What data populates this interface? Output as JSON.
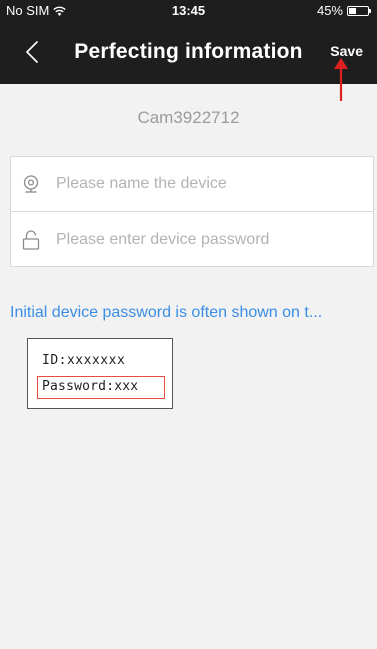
{
  "status_bar": {
    "carrier": "No SIM",
    "time": "13:45",
    "battery_percent": "45%",
    "battery_level": 0.45,
    "icons": [
      "wifi-icon",
      "battery-icon"
    ]
  },
  "nav": {
    "title": "Perfecting information",
    "save_label": "Save",
    "back_icon": "chevron-left-icon"
  },
  "device": {
    "id": "Cam3922712"
  },
  "form": {
    "name_placeholder": "Please name the device",
    "name_value": "",
    "name_icon": "camera-icon",
    "password_placeholder": "Please enter device password",
    "password_value": "",
    "password_icon": "lock-icon"
  },
  "hint": {
    "text": "Initial device password is often shown on t..."
  },
  "label_example": {
    "id_line": "ID:xxxxxxx",
    "password_line": "Password:xxx"
  },
  "colors": {
    "bar_background": "#1e1e1e",
    "page_background": "#f2f2f2",
    "hint_text": "#3a8ee6",
    "annotation_red": "#e02020",
    "highlight_red": "#e74c3c"
  }
}
